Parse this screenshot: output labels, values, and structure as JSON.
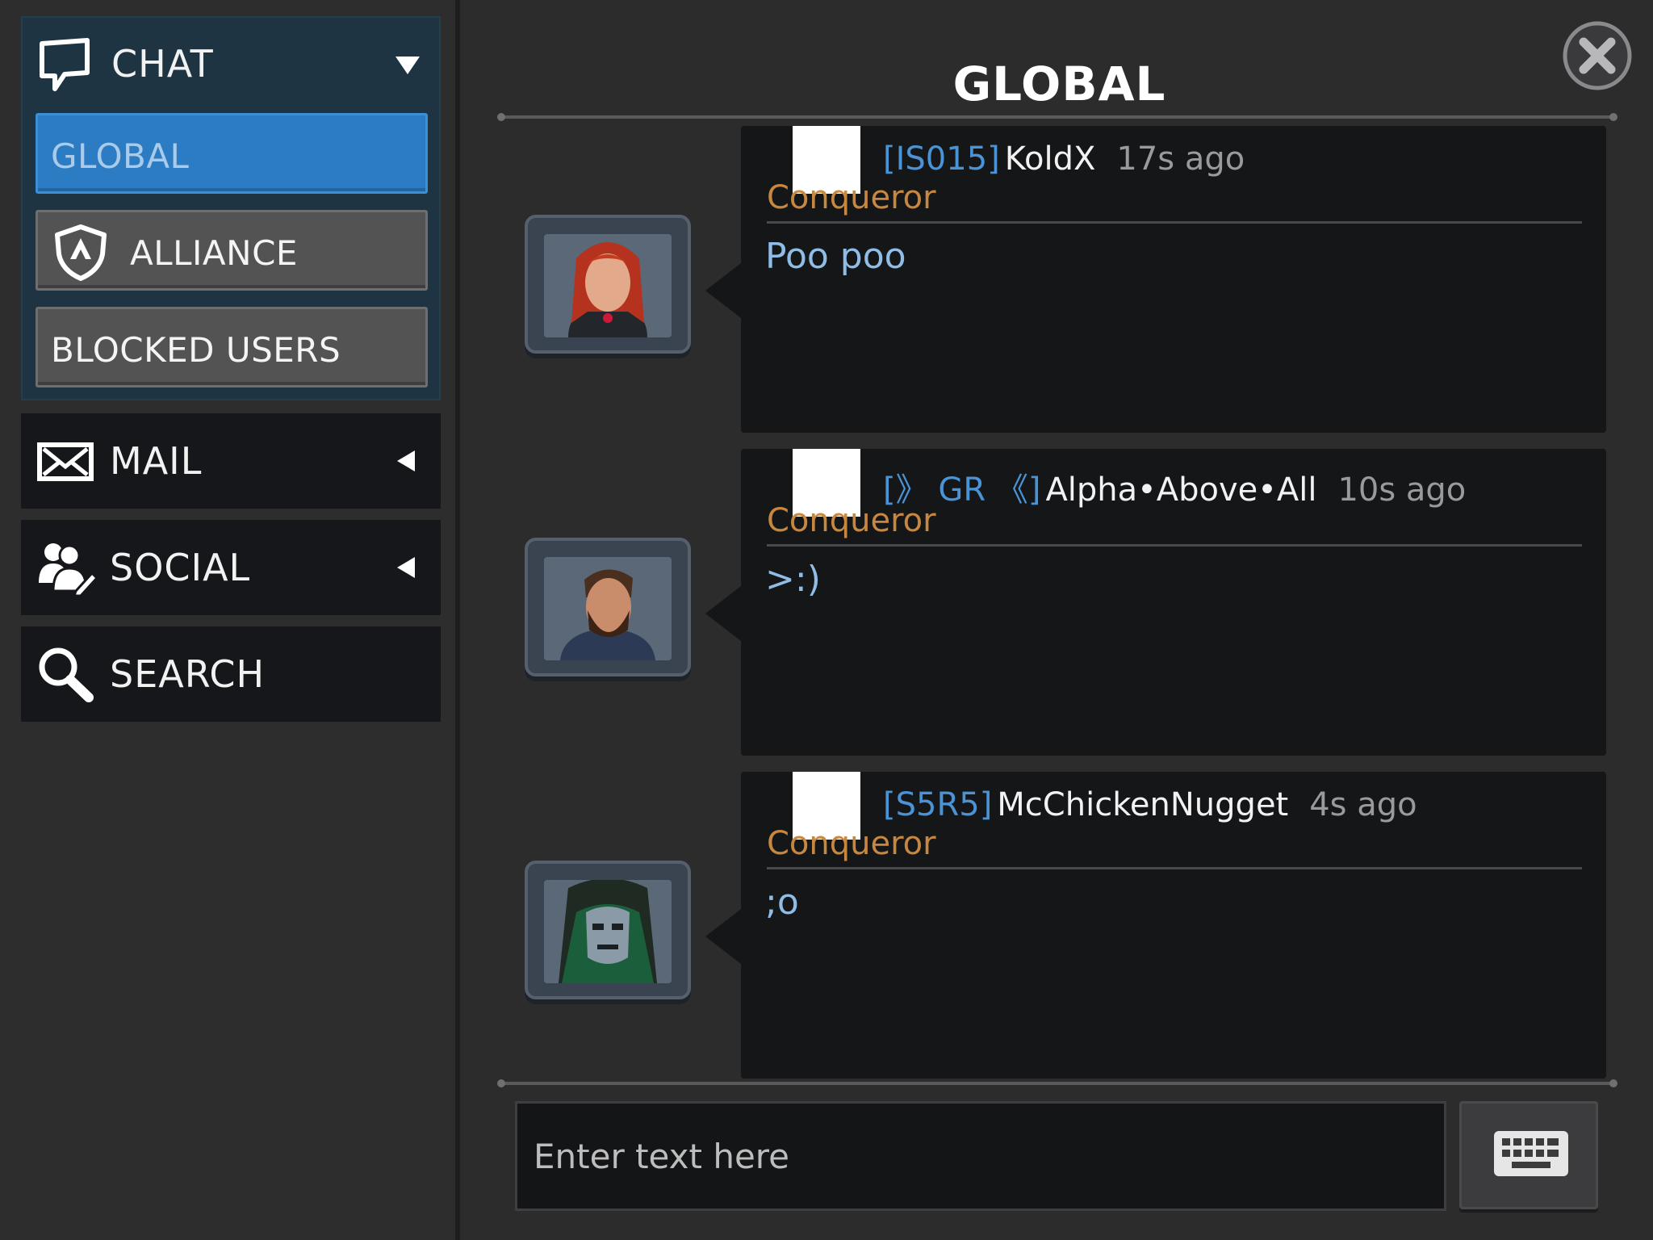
{
  "sidebar": {
    "chat": {
      "label": "CHAT",
      "icon": "chat-bubble-icon",
      "expanded": true
    },
    "chat_tabs": [
      {
        "label": "GLOBAL",
        "active": true
      },
      {
        "label": "ALLIANCE",
        "icon": "alliance-shield-icon",
        "active": false
      },
      {
        "label": "BLOCKED USERS",
        "active": false
      }
    ],
    "nav": [
      {
        "label": "MAIL",
        "icon": "mail-icon"
      },
      {
        "label": "SOCIAL",
        "icon": "social-users-icon"
      },
      {
        "label": "SEARCH",
        "icon": "search-icon"
      }
    ]
  },
  "main": {
    "title": "GLOBAL",
    "messages": [
      {
        "tag": "[IS015]",
        "name": "KoldX",
        "time": "17s ago",
        "role": "Conqueror",
        "text": "Poo poo",
        "avatar": "red-haired-hero-portrait"
      },
      {
        "tag": "[》 GR 《]",
        "name": "Alpha•Above•All",
        "time": "10s ago",
        "role": "Conqueror",
        "text": ">:)",
        "avatar": "bearded-hero-portrait"
      },
      {
        "tag": "[S5R5]",
        "name": "McChickenNugget",
        "time": "4s ago",
        "role": "Conqueror",
        "text": ";o",
        "avatar": "masked-villain-portrait"
      }
    ],
    "input": {
      "placeholder": "Enter text here",
      "value": ""
    }
  },
  "colors": {
    "accent": "#2b7cc2",
    "tag": "#4a93d6",
    "role": "#c8873f",
    "message_text": "#8fbde6"
  }
}
